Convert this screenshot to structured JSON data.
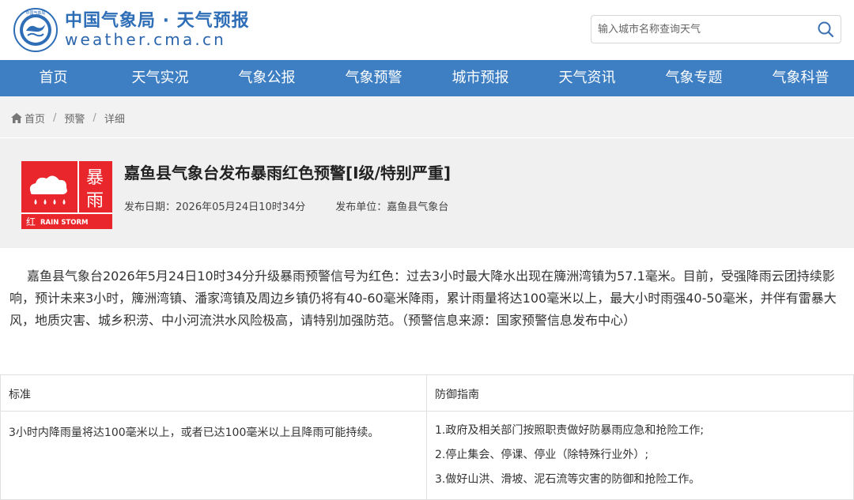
{
  "header": {
    "brand_cn": "中国气象局 · 天气预报",
    "brand_en": "weather.cma.cn",
    "logo_text": "中国气象局",
    "search": {
      "placeholder": "输入城市名称查询天气",
      "value": ""
    }
  },
  "nav": {
    "items": [
      {
        "label": "首页"
      },
      {
        "label": "天气实况"
      },
      {
        "label": "气象公报"
      },
      {
        "label": "气象预警"
      },
      {
        "label": "城市预报"
      },
      {
        "label": "天气资讯"
      },
      {
        "label": "气象专题"
      },
      {
        "label": "气象科普"
      }
    ]
  },
  "breadcrumb": {
    "home": "首页",
    "separator": "/",
    "level2": "预警",
    "level3": "详细"
  },
  "alert": {
    "icon": {
      "name": "rainstorm-red-icon",
      "char1": "暴",
      "char2": "雨",
      "level_char": "红",
      "label_en": "RAIN STORM",
      "bg_color": "#e8262b"
    },
    "title": "嘉鱼县气象台发布暴雨红色预警[I级/特别严重]",
    "date_label": "发布日期：",
    "date_value": "2026年05月24日10时34分",
    "unit_label": "发布单位：",
    "unit_value": "嘉鱼县气象台"
  },
  "content": {
    "text": "嘉鱼县气象台2026年5月24日10时34分升级暴雨预警信号为红色：过去3小时最大降水出现在簰洲湾镇为57.1毫米。目前，受强降雨云团持续影响，预计未来3小时，簰洲湾镇、潘家湾镇及周边乡镇仍将有40-60毫米降雨，累计雨量将达100毫米以上，最大小时雨强40-50毫米，并伴有雷暴大风，地质灾害、城乡积涝、中小河流洪水风险极高，请特别加强防范。（预警信息来源：国家预警信息发布中心）"
  },
  "guide_table": {
    "headers": [
      "标准",
      "防御指南"
    ],
    "standard": "3小时内降雨量将达100毫米以上，或者已达100毫米以上且降雨可能持续。",
    "guidelines": [
      "1.政府及相关部门按照职责做好防暴雨应急和抢险工作;",
      "2.停止集会、停课、停业（除特殊行业外）;",
      "3.做好山洪、滑坡、泥石流等灾害的防御和抢险工作。"
    ]
  },
  "colors": {
    "brand_blue": "#2e6eb7",
    "nav_bg": "#3e7fc4",
    "alert_red": "#e8262b",
    "panel_gray": "#f0f0f0"
  }
}
